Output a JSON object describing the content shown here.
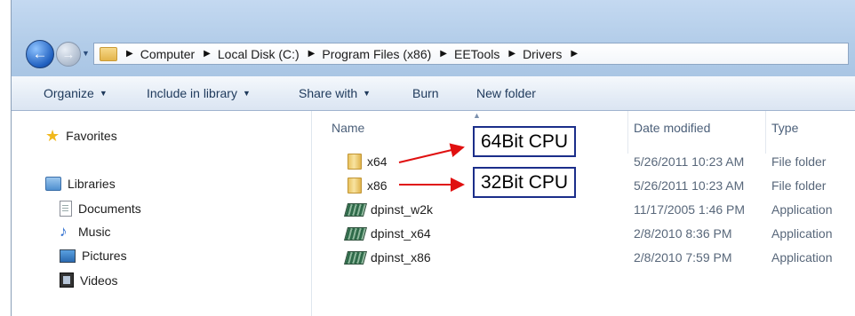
{
  "address": {
    "crumbs": [
      "Computer",
      "Local Disk (C:)",
      "Program Files (x86)",
      "EETools",
      "Drivers"
    ]
  },
  "toolbar": {
    "organize": "Organize",
    "include_in_library": "Include in library",
    "share_with": "Share with",
    "burn": "Burn",
    "new_folder": "New folder"
  },
  "nav": {
    "favorites": "Favorites",
    "libraries": "Libraries",
    "library_items": [
      "Documents",
      "Music",
      "Pictures",
      "Videos"
    ]
  },
  "columns": {
    "name": "Name",
    "date_modified": "Date modified",
    "type": "Type"
  },
  "files": [
    {
      "name": "x64",
      "date": "5/26/2011 10:23 AM",
      "type": "File folder",
      "icon": "folder-icon"
    },
    {
      "name": "x86",
      "date": "5/26/2011 10:23 AM",
      "type": "File folder",
      "icon": "folder-icon"
    },
    {
      "name": "dpinst_w2k",
      "date": "11/17/2005 1:46 PM",
      "type": "Application",
      "icon": "application-icon"
    },
    {
      "name": "dpinst_x64",
      "date": "2/8/2010 8:36 PM",
      "type": "Application",
      "icon": "application-icon"
    },
    {
      "name": "dpinst_x86",
      "date": "2/8/2010 7:59 PM",
      "type": "Application",
      "icon": "application-icon"
    }
  ],
  "annotations": {
    "x64_label": "64Bit CPU",
    "x86_label": "32Bit CPU",
    "arrow_color": "#e01010",
    "box_color": "#1b2e8a"
  }
}
